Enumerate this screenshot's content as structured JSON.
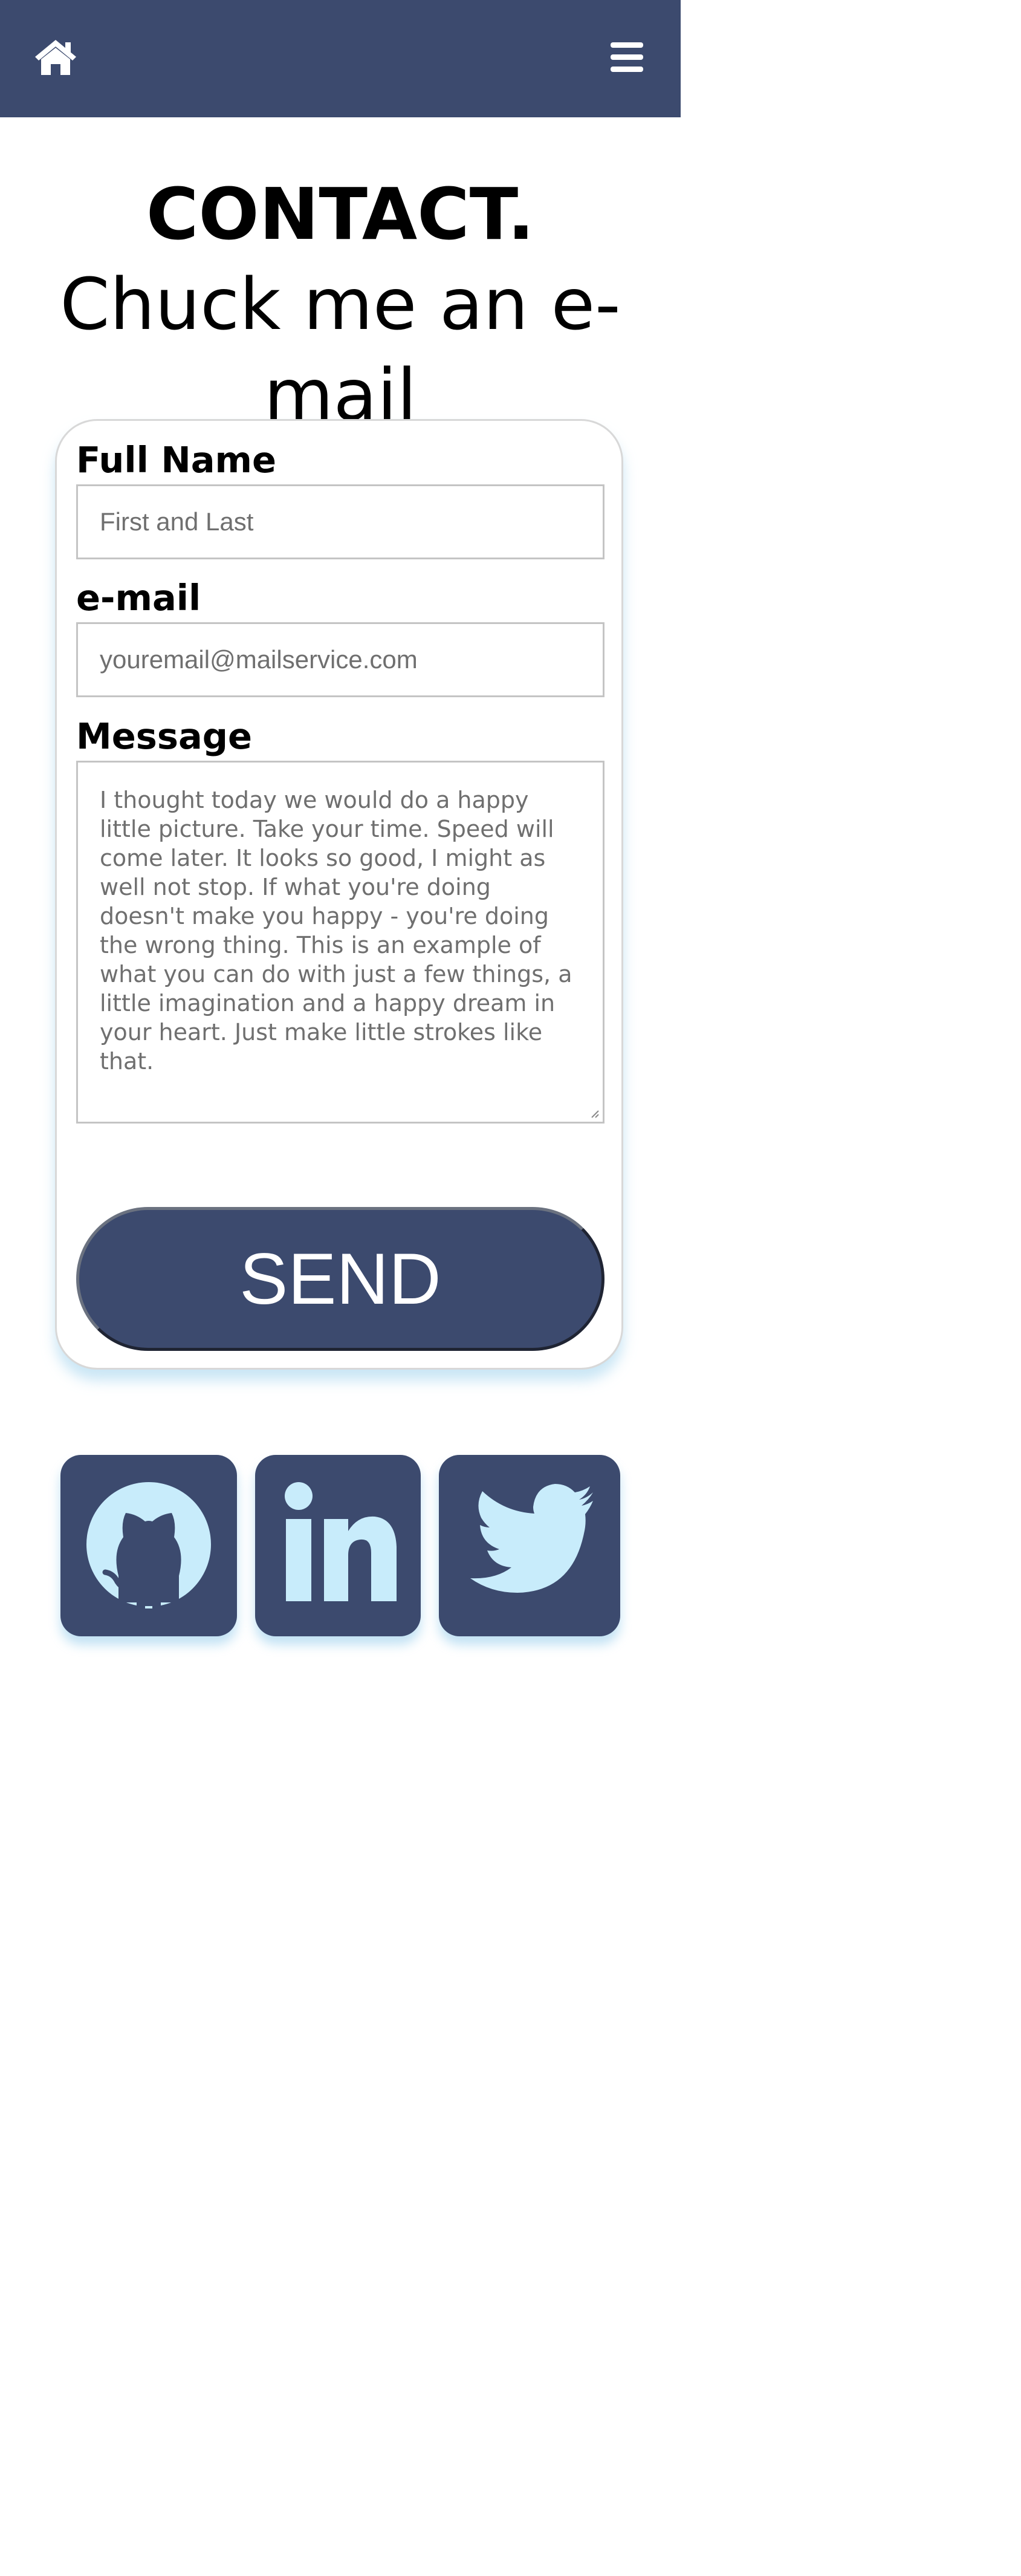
{
  "nav": {
    "home_icon": "home-icon",
    "menu_icon": "hamburger-menu-icon"
  },
  "header": {
    "title": "CONTACT.",
    "subtitle": "Chuck me an e-mail"
  },
  "form": {
    "name_label": "Full Name",
    "name_placeholder": "First and Last",
    "email_label": "e-mail",
    "email_placeholder": "youremail@mailservice.com",
    "message_label": "Message",
    "message_placeholder": "I thought today we would do a happy little picture. Take your time. Speed will come later. It looks so good, I might as well not stop. If what you're doing doesn't make you happy - you're doing the wrong thing. This is an example of what you can do with just a few things, a little imagination and a happy dream in your heart. Just make little strokes like that.",
    "send_label": "SEND"
  },
  "social": [
    {
      "icon": "github-icon"
    },
    {
      "icon": "linkedin-icon"
    },
    {
      "icon": "twitter-icon"
    }
  ],
  "colors": {
    "primary": "#3c4a6e",
    "icon_fill": "#c8ecfb",
    "shadow": "#add8f0"
  }
}
